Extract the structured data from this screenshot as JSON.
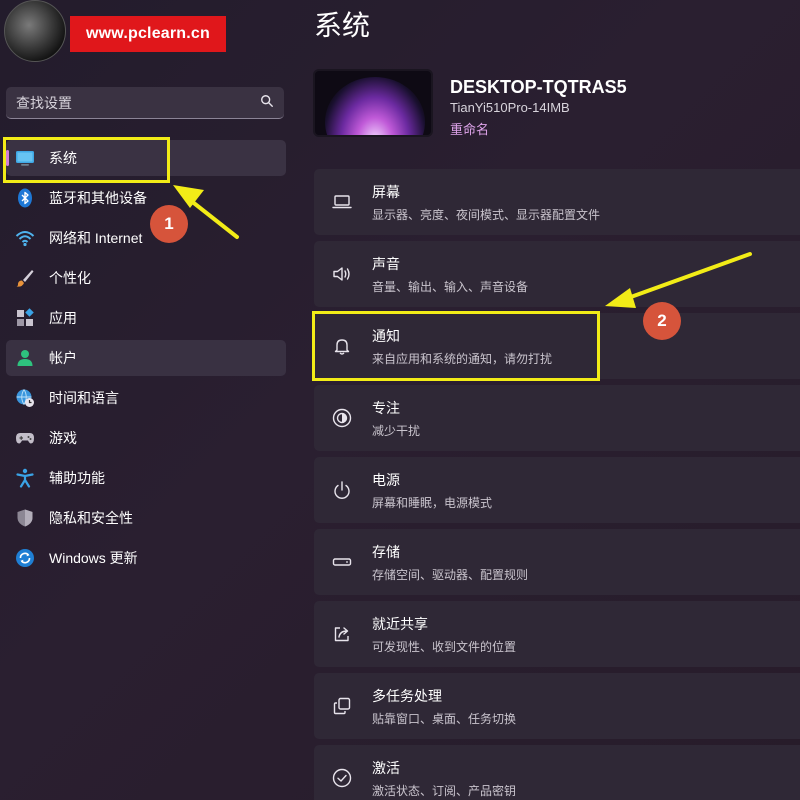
{
  "watermark": "www.pclearn.cn",
  "search": {
    "placeholder": "查找设置",
    "icon": "search-icon"
  },
  "sidebar": {
    "items": [
      {
        "label": "系统",
        "icon": "display-icon",
        "selected": true
      },
      {
        "label": "蓝牙和其他设备",
        "icon": "bluetooth-icon"
      },
      {
        "label": "网络和 Internet",
        "icon": "wifi-icon"
      },
      {
        "label": "个性化",
        "icon": "brush-icon"
      },
      {
        "label": "应用",
        "icon": "apps-icon"
      },
      {
        "label": "帐户",
        "icon": "account-icon"
      },
      {
        "label": "时间和语言",
        "icon": "globe-clock-icon"
      },
      {
        "label": "游戏",
        "icon": "gamepad-icon"
      },
      {
        "label": "辅助功能",
        "icon": "accessibility-icon"
      },
      {
        "label": "隐私和安全性",
        "icon": "shield-icon"
      },
      {
        "label": "Windows 更新",
        "icon": "update-icon"
      }
    ]
  },
  "main": {
    "title": "系统",
    "device": {
      "name": "DESKTOP-TQTRAS5",
      "model": "TianYi510Pro-14IMB",
      "rename": "重命名"
    },
    "cards": [
      {
        "title": "屏幕",
        "subtitle": "显示器、亮度、夜间模式、显示器配置文件",
        "icon": "laptop-icon"
      },
      {
        "title": "声音",
        "subtitle": "音量、输出、输入、声音设备",
        "icon": "speaker-icon"
      },
      {
        "title": "通知",
        "subtitle": "来自应用和系统的通知，请勿打扰",
        "icon": "bell-icon"
      },
      {
        "title": "专注",
        "subtitle": "减少干扰",
        "icon": "focus-icon"
      },
      {
        "title": "电源",
        "subtitle": "屏幕和睡眠，电源模式",
        "icon": "power-icon"
      },
      {
        "title": "存储",
        "subtitle": "存储空间、驱动器、配置规则",
        "icon": "storage-icon"
      },
      {
        "title": "就近共享",
        "subtitle": "可发现性、收到文件的位置",
        "icon": "share-icon"
      },
      {
        "title": "多任务处理",
        "subtitle": "贴靠窗口、桌面、任务切换",
        "icon": "multitask-icon"
      },
      {
        "title": "激活",
        "subtitle": "激活状态、订阅、产品密钥",
        "icon": "activation-icon"
      }
    ]
  },
  "annotations": [
    {
      "number": "1"
    },
    {
      "number": "2"
    }
  ],
  "colors": {
    "background": "#271e2d",
    "selected_indicator": "#d27fd9",
    "link": "#dea3ea",
    "highlight": "#f2ec17",
    "badge": "#d6543b",
    "watermark": "#e0171b"
  }
}
